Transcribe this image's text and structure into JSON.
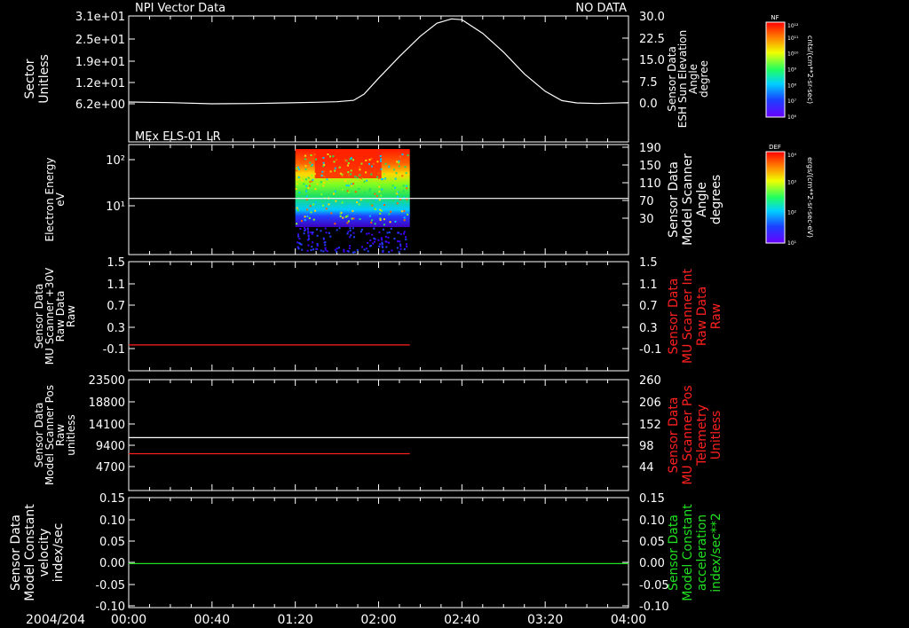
{
  "date_label": "2004/204",
  "x_ticks": [
    "00:00",
    "00:40",
    "01:20",
    "02:00",
    "02:40",
    "03:20",
    "04:00"
  ],
  "colors": {
    "bg": "#000000",
    "fg": "#ffffff",
    "red": "#ff2020",
    "green": "#20e020"
  },
  "colorbars": [
    {
      "title": "NF",
      "top_label": "10¹²",
      "labels": [
        "10¹¹",
        "10¹⁰",
        "10⁹",
        "10⁸",
        "10⁷",
        "10⁶"
      ],
      "unit": "cnts/(cm**2-sr-sec)"
    },
    {
      "title": "DEF",
      "top_label": "10⁴",
      "labels": [
        "10³",
        "10²",
        "10¹"
      ],
      "unit": "ergs/(cm**2-sr-sec-eV)"
    }
  ],
  "chart_data": [
    {
      "type": "line",
      "title": "NPI Vector Data",
      "title_right": "NO DATA",
      "left_axis": {
        "label_lines": [
          "Sector",
          "Unitless"
        ],
        "ticks": [
          "3.1e+01",
          "2.5e+01",
          "1.9e+01",
          "1.2e+01",
          "6.2e+00"
        ]
      },
      "right_axis": {
        "label_lines": [
          "Sensor Data",
          "ESH Sun Elevation",
          "Angle",
          "degree"
        ],
        "ticks": [
          "30.0",
          "22.5",
          "15.0",
          "7.5",
          "0.0"
        ],
        "ylim": [
          -1.5,
          31.5
        ]
      },
      "series": [
        {
          "color": "#ffffff",
          "x": [
            0,
            20,
            40,
            60,
            75,
            90,
            100,
            108,
            113,
            120,
            130,
            140,
            148,
            155,
            160,
            170,
            180,
            190,
            200,
            208,
            215,
            225,
            240
          ],
          "y": [
            0.3,
            0.1,
            -0.3,
            -0.2,
            0.0,
            0.2,
            0.4,
            0.9,
            3.0,
            8.5,
            16.0,
            23.0,
            27.5,
            29.0,
            28.7,
            24.0,
            17.5,
            10.0,
            4.0,
            0.8,
            0.0,
            -0.2,
            0.1
          ]
        }
      ]
    },
    {
      "type": "heatmap",
      "title": "MEx ELS-01 LR",
      "left_axis": {
        "label_lines": [
          "Electron Energy",
          "eV"
        ],
        "ticks": [
          "10²",
          "10¹"
        ]
      },
      "right_axis": {
        "label_lines": [
          "Sensor Data",
          "Model Scanner",
          "Angle",
          "degrees"
        ],
        "ticks": [
          "190",
          "150",
          "110",
          "70",
          "30"
        ],
        "ylim": [
          0,
          190
        ]
      },
      "data_window": {
        "x": [
          80,
          135
        ]
      },
      "series": [
        {
          "color": "#ffffff",
          "x": [
            0,
            240
          ],
          "y": [
            97,
            97
          ]
        }
      ]
    },
    {
      "type": "line",
      "left_axis": {
        "label_lines": [
          "Sensor Data",
          "MU Scanner +30V",
          "Raw Data",
          "Raw"
        ],
        "ticks": [
          "1.5",
          "1.1",
          "0.7",
          "0.3",
          "-0.1"
        ],
        "ylim": [
          -0.4,
          1.5
        ]
      },
      "right_axis": {
        "label_lines": [
          "Sensor Data",
          "MU Scanner Int",
          "Raw Data",
          "Raw"
        ],
        "ticks": [
          "1.5",
          "1.1",
          "0.7",
          "0.3",
          "-0.1"
        ],
        "ylim": [
          -0.4,
          1.5
        ],
        "color": "#ff2020"
      },
      "series": [
        {
          "color": "#ff2020",
          "x": [
            0,
            135
          ],
          "y": [
            0.05,
            0.05
          ]
        }
      ]
    },
    {
      "type": "line",
      "left_axis": {
        "label_lines": [
          "Sensor Data",
          "Model Scanner Pos",
          "Raw",
          "unitless"
        ],
        "ticks": [
          "23500",
          "18800",
          "14100",
          "9400",
          "4700"
        ],
        "ylim": [
          0,
          23500
        ]
      },
      "right_axis": {
        "label_lines": [
          "Sensor Data",
          "MU Scanner Pos",
          "Telemetry",
          "Unitless"
        ],
        "ticks": [
          "260",
          "206",
          "152",
          "98",
          "44"
        ],
        "ylim": [
          -10,
          260
        ],
        "color": "#ff2020"
      },
      "series": [
        {
          "color": "#ffffff",
          "x": [
            0,
            240
          ],
          "y": [
            11200,
            11200
          ]
        },
        {
          "color": "#ff2020",
          "x": [
            0,
            135
          ],
          "y": [
            7800,
            7800
          ]
        }
      ]
    },
    {
      "type": "line",
      "left_axis": {
        "label_lines": [
          "Sensor Data",
          "Model Constant",
          "velocity",
          "index/sec"
        ],
        "ticks": [
          "0.15",
          "0.10",
          "0.05",
          "0.00",
          "-0.05",
          "-0.10"
        ],
        "ylim": [
          -0.1,
          0.15
        ]
      },
      "right_axis": {
        "label_lines": [
          "Sensor Data",
          "Model Constant",
          "acceleration",
          "index/sec**2"
        ],
        "ticks": [
          "0.15",
          "0.10",
          "0.05",
          "0.00",
          "-0.05",
          "-0.10"
        ],
        "ylim": [
          -0.1,
          0.15
        ],
        "color": "#20e020"
      },
      "series": [
        {
          "color": "#20e020",
          "x": [
            0,
            240
          ],
          "y": [
            0.0,
            0.0
          ]
        }
      ]
    }
  ]
}
